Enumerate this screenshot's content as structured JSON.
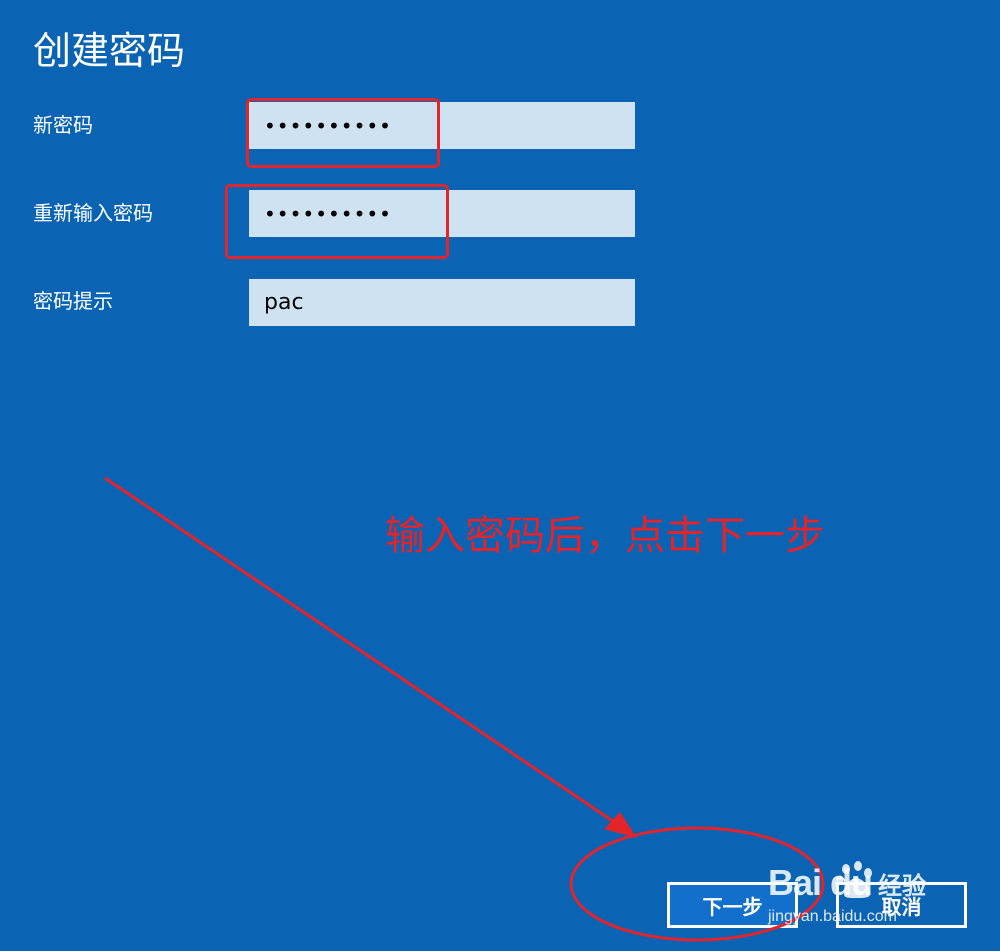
{
  "dialog": {
    "title": "创建密码",
    "fields": [
      {
        "label": "新密码",
        "value": "••••••••••"
      },
      {
        "label": "重新输入密码",
        "value": "••••••••••"
      },
      {
        "label": "密码提示",
        "value": "pac"
      }
    ]
  },
  "buttons": {
    "next_label": "下一步",
    "cancel_label": "取消"
  },
  "annotation": {
    "text": "输入密码后，点击下一步",
    "color": "#e3242b"
  },
  "watermark": {
    "brand": "Bai du",
    "suffix": "经验",
    "url": "jingyan.baidu.com"
  },
  "colors": {
    "background": "#0b63b3",
    "field_background": "#cfe2f1",
    "annotation": "#e3242b"
  }
}
